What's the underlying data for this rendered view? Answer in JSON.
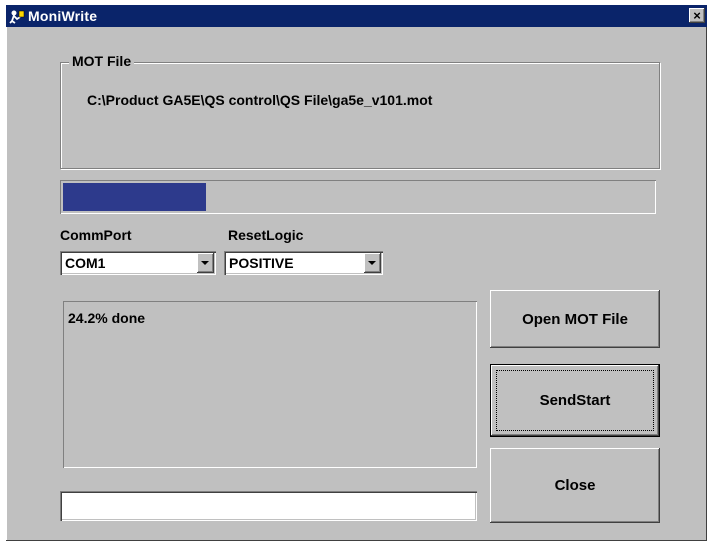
{
  "window": {
    "title": "MoniWrite",
    "close_glyph": "×",
    "app_icon": "moniwrite-app-icon"
  },
  "mot_file": {
    "group_label": "MOT File",
    "path": "C:\\Product GA5E\\QS control\\QS File\\ga5e_v101.mot"
  },
  "progress": {
    "fraction": 0.242,
    "color": "#2d3a8c"
  },
  "comm_port": {
    "label": "CommPort",
    "value": "COM1"
  },
  "reset_logic": {
    "label": "ResetLogic",
    "value": "POSITIVE"
  },
  "log": {
    "text": "24.2% done"
  },
  "status": {
    "value": ""
  },
  "buttons": {
    "open": "Open MOT File",
    "send": "SendStart",
    "close": "Close"
  },
  "colors": {
    "titlebar": "#0a246a",
    "face": "#c0c0c0"
  }
}
